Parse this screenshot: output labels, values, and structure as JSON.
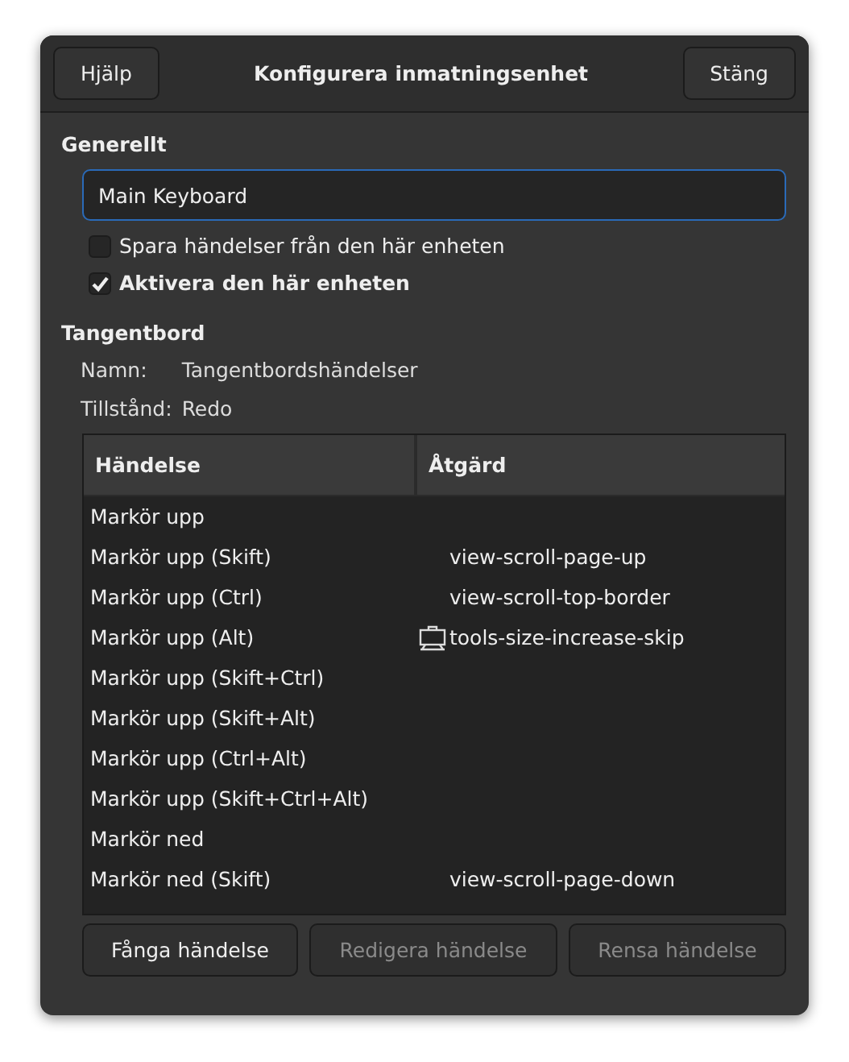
{
  "window": {
    "title": "Konfigurera inmatningsenhet",
    "buttons": [
      {
        "label": "Hjälp"
      },
      {
        "label": "Stäng"
      }
    ]
  },
  "general": {
    "heading": "Generellt",
    "name_value": "Main Keyboard",
    "options": [
      {
        "label": "Spara händelser från den här enheten",
        "checked": false
      },
      {
        "label": "Aktivera den här enheten",
        "checked": true
      }
    ]
  },
  "keyboard": {
    "heading": "Tangentbord",
    "fields": [
      {
        "label": "Namn:",
        "value": "Tangentbordshändelser"
      },
      {
        "label": "Tillstånd:",
        "value": "Redo"
      }
    ]
  },
  "table": {
    "columns": [
      "Händelse",
      "Åtgärd"
    ],
    "rows": [
      {
        "event": "Markör upp",
        "action": "",
        "action_icon": false
      },
      {
        "event": "Markör upp (Skift)",
        "action": "view-scroll-page-up",
        "action_icon": false
      },
      {
        "event": "Markör upp (Ctrl)",
        "action": "view-scroll-top-border",
        "action_icon": false
      },
      {
        "event": "Markör upp (Alt)",
        "action": "tools-size-increase-skip",
        "action_icon": true
      },
      {
        "event": "Markör upp (Skift+Ctrl)",
        "action": "",
        "action_icon": false
      },
      {
        "event": "Markör upp (Skift+Alt)",
        "action": "",
        "action_icon": false
      },
      {
        "event": "Markör upp (Ctrl+Alt)",
        "action": "",
        "action_icon": false
      },
      {
        "event": "Markör upp (Skift+Ctrl+Alt)",
        "action": "",
        "action_icon": false
      },
      {
        "event": "Markör ned",
        "action": "",
        "action_icon": false
      },
      {
        "event": "Markör ned (Skift)",
        "action": "view-scroll-page-down",
        "action_icon": false
      }
    ]
  },
  "buttons": [
    {
      "label": "Fånga händelse",
      "disabled": false
    },
    {
      "label": "Redigera händelse",
      "disabled": true
    },
    {
      "label": "Rensa händelse",
      "disabled": true
    }
  ]
}
